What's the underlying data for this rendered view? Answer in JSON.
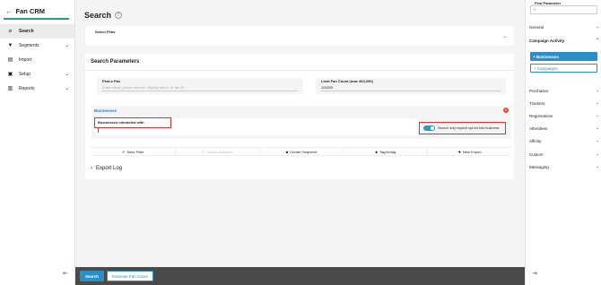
{
  "app": {
    "title": "Fan CRM",
    "back_icon": "arrow-left-icon"
  },
  "sidebar": {
    "items": [
      {
        "label": "Search",
        "icon": "search-icon",
        "glyph": "⌕",
        "active": true,
        "chevron": ""
      },
      {
        "label": "Segments",
        "icon": "funnel-icon",
        "glyph": "▼",
        "active": false,
        "chevron": "⌄"
      },
      {
        "label": "Import",
        "icon": "document-icon",
        "glyph": "▤",
        "active": false,
        "chevron": ""
      },
      {
        "label": "Setup",
        "icon": "setup-icon",
        "glyph": "▣",
        "active": false,
        "chevron": "⌄"
      },
      {
        "label": "Reports",
        "icon": "bar-chart-icon",
        "glyph": "▥",
        "active": false,
        "chevron": "⌄"
      }
    ],
    "collapse_glyph": "⇤"
  },
  "main": {
    "title": "Search",
    "help_glyph": "?",
    "select_filter_label": "Select Filter",
    "params_title": "Search Parameters",
    "find_fan_label": "Find a Fan",
    "find_fan_placeholder": "Enter email, phone number, display name, or fan ID",
    "limit_label": "Limit Fan Count (max 400,000)",
    "limit_value": "100000",
    "businesses_link": "Businesses",
    "businesses_field_label": "Businesses interacted with",
    "optin_label": "Search only explicit opt-ins into business",
    "actions": [
      {
        "label": "Save Filter",
        "glyph": "✔",
        "disabled": false
      },
      {
        "label": "Create Audience",
        "glyph": "⇪",
        "disabled": true
      },
      {
        "label": "Create Snapshot",
        "glyph": "◙",
        "disabled": false
      },
      {
        "label": "Tag/Untag",
        "glyph": "⬥",
        "disabled": false
      },
      {
        "label": "New Export",
        "glyph": "✚",
        "disabled": false
      }
    ],
    "export_log": "Export Log",
    "search_button": "Search",
    "estimate_button": "Estimate Fan Count"
  },
  "right_panel": {
    "find_parameter_label": "Find Parameter",
    "categories_top": [
      {
        "label": "General"
      }
    ],
    "campaign_activity": "Campaign Activity",
    "businesses_button": "+ Businesses",
    "campaigns_button": "+ Campaigns",
    "categories_bottom": [
      {
        "label": "Purchases"
      },
      {
        "label": "Trackers"
      },
      {
        "label": "Registrations"
      },
      {
        "label": "Attendees"
      },
      {
        "label": "Affinity"
      },
      {
        "label": "Custom"
      },
      {
        "label": "Messaging"
      }
    ],
    "collapse_glyph": "⇥"
  },
  "colors": {
    "accent": "#2a8ec8",
    "brand_line": "#2e9c7e",
    "highlight": "#e03030",
    "toggle": "#2e9bb8"
  }
}
